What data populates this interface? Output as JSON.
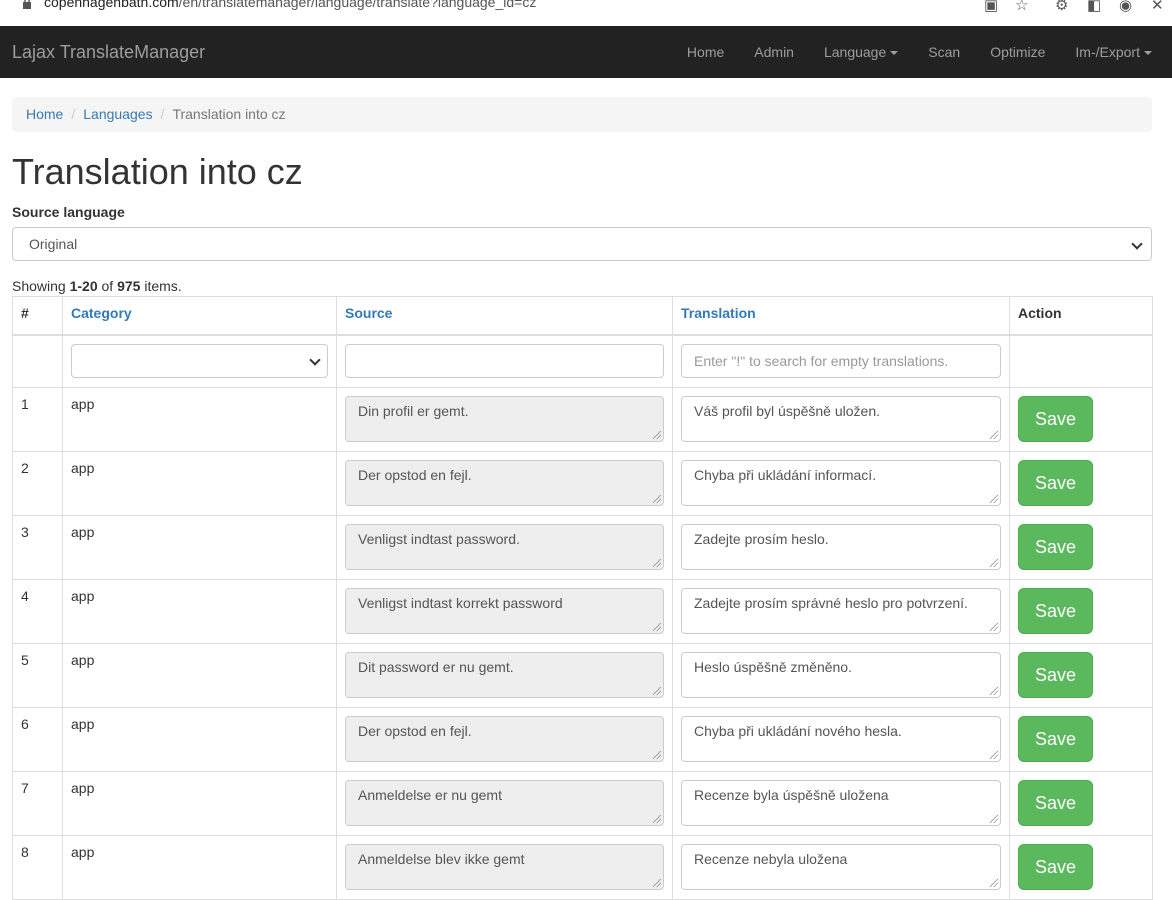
{
  "browser": {
    "url_domain": "copenhagenbath.com",
    "url_path": "/en/translatemanager/language/translate?language_id=cz"
  },
  "navbar": {
    "brand": "Lajax TranslateManager",
    "items": [
      {
        "label": "Home",
        "dropdown": false
      },
      {
        "label": "Admin",
        "dropdown": false
      },
      {
        "label": "Language",
        "dropdown": true
      },
      {
        "label": "Scan",
        "dropdown": false
      },
      {
        "label": "Optimize",
        "dropdown": false
      },
      {
        "label": "Im-/Export",
        "dropdown": true
      }
    ]
  },
  "breadcrumb": {
    "home": "Home",
    "languages": "Languages",
    "current": "Translation into cz"
  },
  "page": {
    "title": "Translation into cz",
    "source_language_label": "Source language",
    "source_language_value": "Original"
  },
  "summary": {
    "prefix": "Showing ",
    "range": "1-20",
    "of": " of ",
    "total": "975",
    "suffix": " items."
  },
  "table": {
    "headers": {
      "num": "#",
      "category": "Category",
      "source": "Source",
      "translation": "Translation",
      "action": "Action"
    },
    "filters": {
      "translation_placeholder": "Enter \"!\" to search for empty translations."
    },
    "save_label": "Save",
    "rows": [
      {
        "num": "1",
        "category": "app",
        "source": "Din profil er gemt.",
        "translation": "Váš profil byl úspěšně uložen."
      },
      {
        "num": "2",
        "category": "app",
        "source": "Der opstod en fejl.",
        "translation": "Chyba při ukládání informací."
      },
      {
        "num": "3",
        "category": "app",
        "source": "Venligst indtast password.",
        "translation": "Zadejte prosím heslo."
      },
      {
        "num": "4",
        "category": "app",
        "source": "Venligst indtast korrekt password",
        "translation": "Zadejte prosím správné heslo pro potvrzení."
      },
      {
        "num": "5",
        "category": "app",
        "source": "Dit password er nu gemt.",
        "translation": "Heslo úspěšně změněno."
      },
      {
        "num": "6",
        "category": "app",
        "source": "Der opstod en fejl.",
        "translation": "Chyba při ukládání nového hesla."
      },
      {
        "num": "7",
        "category": "app",
        "source": "Anmeldelse er nu gemt",
        "translation": "Recenze byla úspěšně uložena"
      },
      {
        "num": "8",
        "category": "app",
        "source": "Anmeldelse blev ikke gemt",
        "translation": "Recenze nebyla uložena"
      }
    ]
  }
}
